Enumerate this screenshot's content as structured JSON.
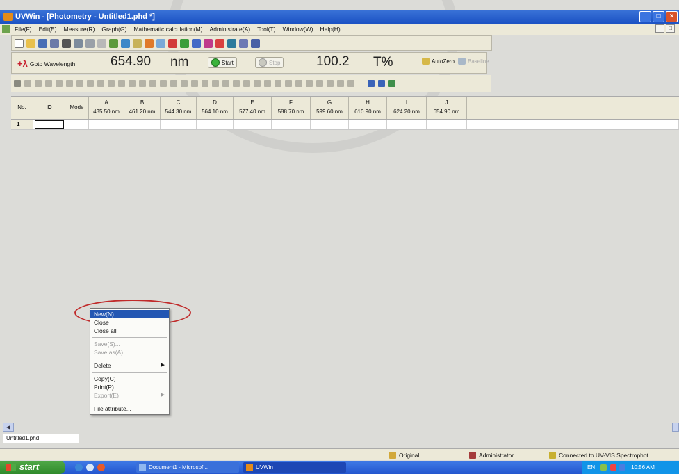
{
  "window": {
    "title": "UVWin - [Photometry - Untitled1.phd *]",
    "controls": [
      "_",
      "□",
      "×"
    ],
    "mdi_controls": [
      "_",
      "□"
    ]
  },
  "menu": [
    "File(F)",
    "Edit(E)",
    "Measure(R)",
    "Graph(G)",
    "Mathematic calculation(M)",
    "Administrate(A)",
    "Tool(T)",
    "Window(W)",
    "Help(H)"
  ],
  "toolbar2": {
    "goto_label": "Goto Wavelength",
    "wavelength_value": "654.90",
    "wavelength_unit": "nm",
    "start_label": "Start",
    "stop_label": "Stop",
    "reading_value": "100.2",
    "reading_unit": "T%",
    "autozero_label": "AutoZero",
    "baseline_label": "Baseline"
  },
  "grid": {
    "headers": {
      "no": "No.",
      "id": "ID",
      "mode": "Mode"
    },
    "columns": [
      {
        "letter": "A",
        "wavelength": "435.50 nm"
      },
      {
        "letter": "B",
        "wavelength": "461.20 nm"
      },
      {
        "letter": "C",
        "wavelength": "544.30 nm"
      },
      {
        "letter": "D",
        "wavelength": "564.10 nm"
      },
      {
        "letter": "E",
        "wavelength": "577.40 nm"
      },
      {
        "letter": "F",
        "wavelength": "588.70 nm"
      },
      {
        "letter": "G",
        "wavelength": "599.60 nm"
      },
      {
        "letter": "H",
        "wavelength": "610.90 nm"
      },
      {
        "letter": "I",
        "wavelength": "624.20 nm"
      },
      {
        "letter": "J",
        "wavelength": "654.90 nm"
      }
    ],
    "rows": [
      {
        "no": "1"
      }
    ]
  },
  "context_menu": {
    "items": [
      {
        "label": "New(N)",
        "state": "selected"
      },
      {
        "label": "Close",
        "state": "normal"
      },
      {
        "label": "Close all",
        "state": "normal"
      },
      {
        "separator": true
      },
      {
        "label": "Save(S)...",
        "state": "disabled"
      },
      {
        "label": "Save as(A)...",
        "state": "disabled"
      },
      {
        "separator": true
      },
      {
        "label": "Delete",
        "state": "normal",
        "submenu": true
      },
      {
        "separator": true
      },
      {
        "label": "Copy(C)",
        "state": "normal"
      },
      {
        "label": "Print(P)...",
        "state": "normal"
      },
      {
        "label": "Export(E)",
        "state": "disabled",
        "submenu": true
      },
      {
        "separator": true
      },
      {
        "label": "File attribute...",
        "state": "normal"
      }
    ]
  },
  "doc_tab": "Untitled1.phd",
  "statusbar": {
    "mode": "Original",
    "user": "Administrator",
    "connection": "Connected to UV-VIS Spectrophot"
  },
  "taskbar": {
    "start": "start",
    "tasks": [
      "Document1 - Microsof...",
      "UVWin"
    ],
    "tray_lang": "EN",
    "clock": "10:56 AM"
  },
  "colors": {
    "titlebar": "#1c52c4",
    "menu_bg": "#ece9d8",
    "selection": "#2457b3",
    "highlight_ring": "#c02a2a",
    "start_green": "#2f8a2b"
  }
}
